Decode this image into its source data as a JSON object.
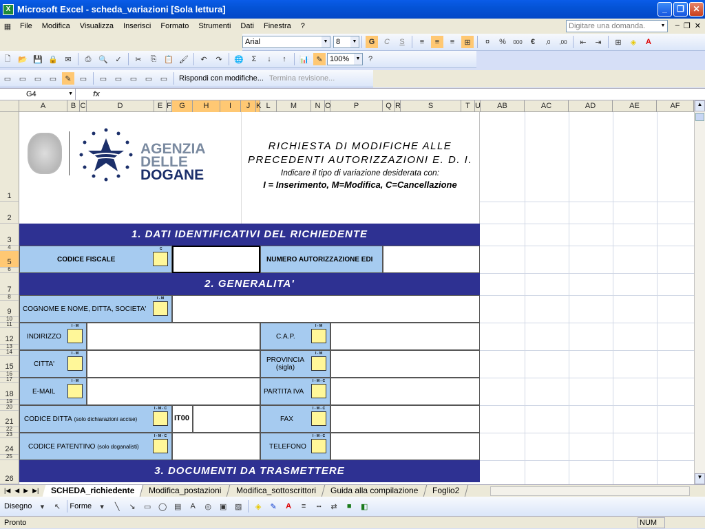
{
  "window": {
    "title": "Microsoft Excel - scheda_variazioni  [Sola lettura]"
  },
  "menu": {
    "items": [
      "File",
      "Modifica",
      "Visualizza",
      "Inserisci",
      "Formato",
      "Strumenti",
      "Dati",
      "Finestra",
      "?"
    ],
    "ask_placeholder": "Digitare una domanda."
  },
  "format_toolbar": {
    "font": "Arial",
    "size": "8",
    "bold": "G",
    "italic": "C",
    "underline": "S"
  },
  "standard_toolbar": {
    "zoom": "100%"
  },
  "review_toolbar": {
    "reply": "Rispondi con modifiche...",
    "end": "Termina revisione..."
  },
  "formula_bar": {
    "cell": "G4",
    "fx": "fx"
  },
  "columns": [
    {
      "label": "A"
    },
    {
      "label": "B"
    },
    {
      "label": "C"
    },
    {
      "label": "D"
    },
    {
      "label": "E"
    },
    {
      "label": "F"
    },
    {
      "label": "G",
      "selected": true
    },
    {
      "label": "H",
      "selected": true
    },
    {
      "label": "I",
      "selected": true
    },
    {
      "label": "J",
      "selected": true
    },
    {
      "label": "K",
      "selected": true
    },
    {
      "label": "L"
    },
    {
      "label": "M"
    },
    {
      "label": "N"
    },
    {
      "label": "O"
    },
    {
      "label": "P"
    },
    {
      "label": "Q"
    },
    {
      "label": "R"
    },
    {
      "label": "S"
    },
    {
      "label": "T"
    },
    {
      "label": "U"
    },
    {
      "label": "AB"
    },
    {
      "label": "AC"
    },
    {
      "label": "AD"
    },
    {
      "label": "AE"
    },
    {
      "label": "AF"
    }
  ],
  "rows": [
    {
      "label": "1"
    },
    {
      "label": "2"
    },
    {
      "label": "3"
    },
    {
      "label": "4"
    },
    {
      "label": "5"
    },
    {
      "label": "6"
    },
    {
      "label": "7"
    },
    {
      "label": "8"
    },
    {
      "label": "9"
    },
    {
      "label": "10"
    },
    {
      "label": "11"
    },
    {
      "label": "12"
    },
    {
      "label": "13"
    },
    {
      "label": "14"
    },
    {
      "label": "15"
    },
    {
      "label": "16"
    },
    {
      "label": "17"
    },
    {
      "label": "18"
    },
    {
      "label": "19"
    },
    {
      "label": "20"
    },
    {
      "label": "21"
    },
    {
      "label": "22"
    },
    {
      "label": "23"
    },
    {
      "label": "24"
    },
    {
      "label": "25"
    },
    {
      "label": "26"
    }
  ],
  "logo": {
    "line1": "AGENZIA",
    "line2": "DELLE",
    "line3": "DOGANE"
  },
  "form": {
    "title1": "RICHIESTA  DI  MODIFICHE  ALLE",
    "title2": "PRECEDENTI  AUTORIZZAZIONI  E. D. I.",
    "subtitle": "Indicare il tipo di variazione desiderata con:",
    "legend": "I = Inserimento, M=Modifica, C=Cancellazione",
    "section1": "1. DATI  IDENTIFICATIVI  DEL  RICHIEDENTE",
    "section2": "2. GENERALITA'",
    "section3": "3. DOCUMENTI  DA  TRASMETTERE",
    "codice_fiscale": "CODICE FISCALE",
    "numero_aut": "NUMERO AUTORIZZAZIONE EDI",
    "cognome": "COGNOME E NOME, DITTA, SOCIETA'",
    "indirizzo": "INDIRIZZO",
    "cap": "C.A.P.",
    "citta": "CITTA'",
    "provincia1": "PROVINCIA",
    "provincia2": "(sigla)",
    "email": "E-MAIL",
    "partita_iva": "PARTITA IVA",
    "codice_ditta": "CODICE DITTA",
    "codice_ditta_note": "(solo dichiarazioni accise)",
    "codice_ditta_value": "IT00",
    "fax": "FAX",
    "codice_patentino": "CODICE PATENTINO",
    "codice_patentino_note": "(solo doganalisti)",
    "telefono": "TELEFONO",
    "mark_c": "C",
    "mark_im": "I - M",
    "mark_imc": "I - M - C"
  },
  "sheets": {
    "tabs": [
      "SCHEDA_richiedente",
      "Modifica_postazioni",
      "Modifica_sottoscrittori",
      "Guida alla compilazione",
      "Foglio2"
    ],
    "active": 0
  },
  "draw_toolbar": {
    "disegno": "Disegno",
    "forme": "Forme"
  },
  "status": {
    "text": "Pronto",
    "num": "NUM"
  },
  "colors": {
    "section_bg": "#2e3192",
    "label_bg": "#a6cbf0",
    "checkbox_bg": "#fff799",
    "title_bar": "#0453d6"
  }
}
